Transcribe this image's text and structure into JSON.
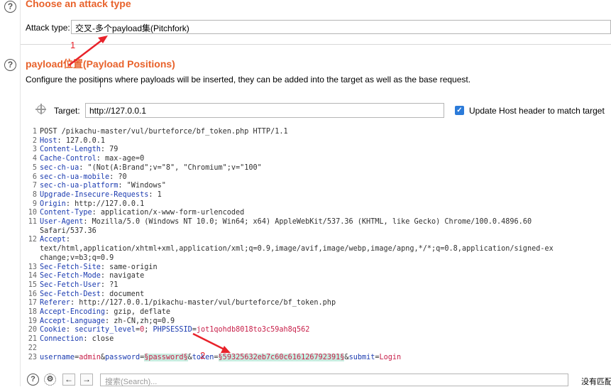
{
  "attack": {
    "title": "Choose an attack type",
    "label": "Attack type:",
    "value": "交叉-多个payload集(Pitchfork)"
  },
  "positions": {
    "title": "payload位置(Payload Positions)",
    "description": "Configure the positions where payloads will be inserted, they can be added into the target as well as the base request.",
    "target_label": "Target:",
    "target_value": "http://127.0.0.1",
    "update_host_label": "Update Host header to match target",
    "update_host_checked": true
  },
  "request_lines": [
    {
      "n": "1",
      "parts": [
        {
          "t": "rl",
          "v": "POST /pikachu-master/vul/burteforce/bf_token.php HTTP/1.1"
        }
      ]
    },
    {
      "n": "2",
      "parts": [
        {
          "t": "hn",
          "v": "Host"
        },
        {
          "t": "hv",
          "v": ": 127.0.0.1"
        }
      ]
    },
    {
      "n": "3",
      "parts": [
        {
          "t": "hn",
          "v": "Content-Length"
        },
        {
          "t": "hv",
          "v": ": 79"
        }
      ]
    },
    {
      "n": "4",
      "parts": [
        {
          "t": "hn",
          "v": "Cache-Control"
        },
        {
          "t": "hv",
          "v": ": max-age=0"
        }
      ]
    },
    {
      "n": "5",
      "parts": [
        {
          "t": "hn",
          "v": "sec-ch-ua"
        },
        {
          "t": "hv",
          "v": ": \"(Not(A:Brand\";v=\"8\", \"Chromium\";v=\"100\""
        }
      ]
    },
    {
      "n": "6",
      "parts": [
        {
          "t": "hn",
          "v": "sec-ch-ua-mobile"
        },
        {
          "t": "hv",
          "v": ": ?0"
        }
      ]
    },
    {
      "n": "7",
      "parts": [
        {
          "t": "hn",
          "v": "sec-ch-ua-platform"
        },
        {
          "t": "hv",
          "v": ": \"Windows\""
        }
      ]
    },
    {
      "n": "8",
      "parts": [
        {
          "t": "hn",
          "v": "Upgrade-Insecure-Requests"
        },
        {
          "t": "hv",
          "v": ": 1"
        }
      ]
    },
    {
      "n": "9",
      "parts": [
        {
          "t": "hn",
          "v": "Origin"
        },
        {
          "t": "hv",
          "v": ": http://127.0.0.1"
        }
      ]
    },
    {
      "n": "10",
      "parts": [
        {
          "t": "hn",
          "v": "Content-Type"
        },
        {
          "t": "hv",
          "v": ": application/x-www-form-urlencoded"
        }
      ]
    },
    {
      "n": "11",
      "parts": [
        {
          "t": "hn",
          "v": "User-Agent"
        },
        {
          "t": "hv",
          "v": ": Mozilla/5.0 (Windows NT 10.0; Win64; x64) AppleWebKit/537.36 (KHTML, like Gecko) Chrome/100.0.4896.60"
        }
      ]
    },
    {
      "n": "",
      "parts": [
        {
          "t": "hv",
          "v": "Safari/537.36"
        }
      ]
    },
    {
      "n": "12",
      "parts": [
        {
          "t": "hn",
          "v": "Accept"
        },
        {
          "t": "hv",
          "v": ":"
        }
      ]
    },
    {
      "n": "",
      "parts": [
        {
          "t": "hv",
          "v": "text/html,application/xhtml+xml,application/xml;q=0.9,image/avif,image/webp,image/apng,*/*;q=0.8,application/signed-ex"
        }
      ]
    },
    {
      "n": "",
      "parts": [
        {
          "t": "hv",
          "v": "change;v=b3;q=0.9"
        }
      ]
    },
    {
      "n": "13",
      "parts": [
        {
          "t": "hn",
          "v": "Sec-Fetch-Site"
        },
        {
          "t": "hv",
          "v": ": same-origin"
        }
      ]
    },
    {
      "n": "14",
      "parts": [
        {
          "t": "hn",
          "v": "Sec-Fetch-Mode"
        },
        {
          "t": "hv",
          "v": ": navigate"
        }
      ]
    },
    {
      "n": "15",
      "parts": [
        {
          "t": "hn",
          "v": "Sec-Fetch-User"
        },
        {
          "t": "hv",
          "v": ": ?1"
        }
      ]
    },
    {
      "n": "16",
      "parts": [
        {
          "t": "hn",
          "v": "Sec-Fetch-Dest"
        },
        {
          "t": "hv",
          "v": ": document"
        }
      ]
    },
    {
      "n": "17",
      "parts": [
        {
          "t": "hn",
          "v": "Referer"
        },
        {
          "t": "hv",
          "v": ": http://127.0.0.1/pikachu-master/vul/burteforce/bf_token.php"
        }
      ]
    },
    {
      "n": "18",
      "parts": [
        {
          "t": "hn",
          "v": "Accept-Encoding"
        },
        {
          "t": "hv",
          "v": ": gzip, deflate"
        }
      ]
    },
    {
      "n": "19",
      "parts": [
        {
          "t": "hn",
          "v": "Accept-Language"
        },
        {
          "t": "hv",
          "v": ": zh-CN,zh;q=0.9"
        }
      ]
    },
    {
      "n": "20",
      "parts": [
        {
          "t": "hn",
          "v": "Cookie"
        },
        {
          "t": "hv",
          "v": ": "
        },
        {
          "t": "pn",
          "v": "security_level"
        },
        {
          "t": "sep",
          "v": "="
        },
        {
          "t": "pv",
          "v": "0"
        },
        {
          "t": "sep",
          "v": "; "
        },
        {
          "t": "pn",
          "v": "PHPSESSID"
        },
        {
          "t": "sep",
          "v": "="
        },
        {
          "t": "pv",
          "v": "jot1qohdb8018to3c59ah8q562"
        }
      ]
    },
    {
      "n": "21",
      "parts": [
        {
          "t": "hn",
          "v": "Connection"
        },
        {
          "t": "hv",
          "v": ": close"
        }
      ]
    },
    {
      "n": "22",
      "parts": [
        {
          "t": "hv",
          "v": ""
        }
      ]
    },
    {
      "n": "23",
      "parts": [
        {
          "t": "pn",
          "v": "username"
        },
        {
          "t": "sep",
          "v": "="
        },
        {
          "t": "pv",
          "v": "admin"
        },
        {
          "t": "sep",
          "v": "&"
        },
        {
          "t": "pn",
          "v": "password"
        },
        {
          "t": "sep",
          "v": "="
        },
        {
          "t": "pm",
          "v": "§password§"
        },
        {
          "t": "sep",
          "v": "&"
        },
        {
          "t": "pn",
          "v": "token"
        },
        {
          "t": "sep",
          "v": "="
        },
        {
          "t": "pm",
          "v": "§59325632eb7c60c616126792391§"
        },
        {
          "t": "sep",
          "v": "&"
        },
        {
          "t": "pn",
          "v": "submit"
        },
        {
          "t": "sep",
          "v": "="
        },
        {
          "t": "pv",
          "v": "Login"
        }
      ]
    }
  ],
  "annotations": {
    "one": "1",
    "two": "2",
    "color": "#e8222a"
  },
  "search": {
    "placeholder": "搜索(Search)..."
  },
  "bottom_right_text": "没有匹配",
  "icons": {
    "help": "help-icon",
    "settings": "gear-icon",
    "back": "arrow-left-icon",
    "forward": "arrow-right-icon",
    "target": "crosshair-icon"
  }
}
